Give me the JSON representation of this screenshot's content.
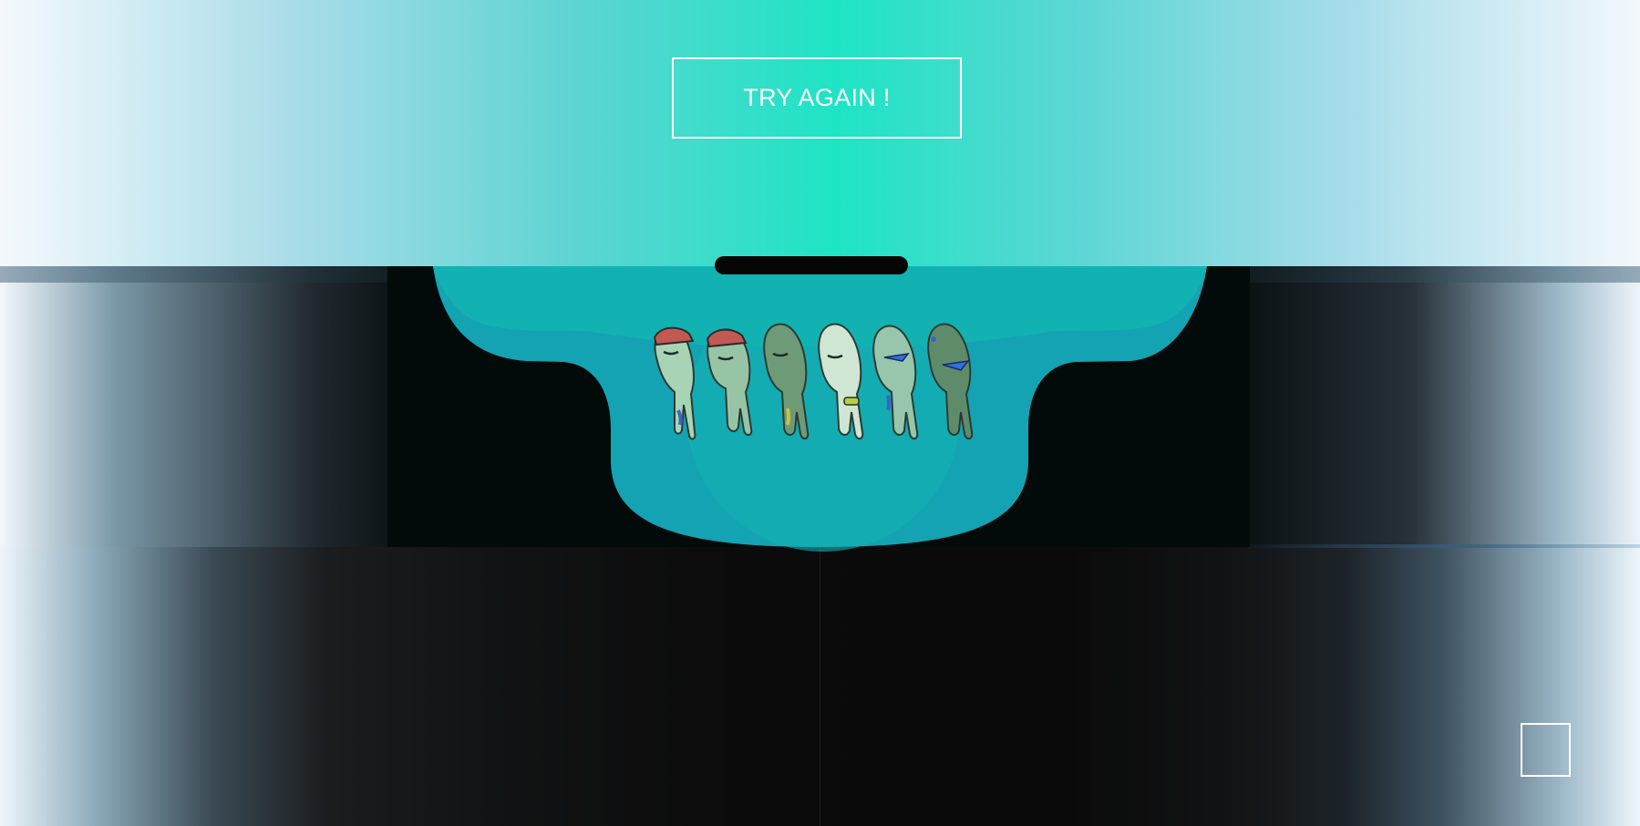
{
  "screen": {
    "retry_button_label": "TRY AGAIN !"
  },
  "scene": {
    "character_count": 6,
    "characters": [
      {
        "accessory": "red-cap"
      },
      {
        "accessory": "red-cap"
      },
      {
        "accessory": "none"
      },
      {
        "accessory": "ring"
      },
      {
        "accessory": "blue-sunglasses"
      },
      {
        "accessory": "blue-sunglasses"
      }
    ]
  },
  "colors": {
    "accent_teal": "#1ee4c4",
    "basin_teal": "#14a3b2",
    "basin_light": "#12b8b4",
    "button_border": "#ffffff"
  },
  "icons": {
    "corner_square": "square-outline-icon",
    "slot": "slot-bar-icon"
  }
}
